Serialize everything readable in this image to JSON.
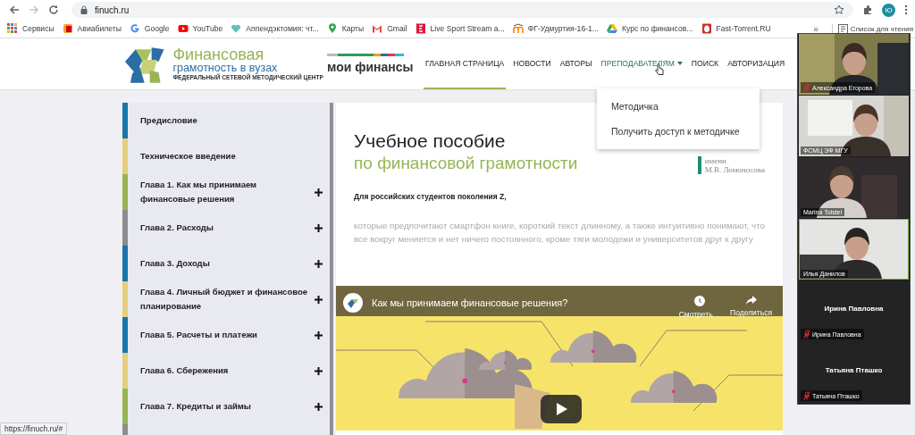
{
  "browser": {
    "address": "finuch.ru",
    "profile_initial": "Ю",
    "bookmarks": [
      {
        "label": "Сервисы",
        "kind": "apps"
      },
      {
        "label": "Авиабилеты",
        "kind": "ticket"
      },
      {
        "label": "Google",
        "kind": "google"
      },
      {
        "label": "YouTube",
        "kind": "youtube"
      },
      {
        "label": "Аппендэктомия: чт...",
        "kind": "heart"
      },
      {
        "label": "Карты",
        "kind": "maps"
      },
      {
        "label": "Gmail",
        "kind": "gmail"
      },
      {
        "label": "Live Sport Stream a...",
        "kind": "sport"
      },
      {
        "label": "ФГ-Удмуртия-16-1...",
        "kind": "moodle"
      },
      {
        "label": "Курс по финансов...",
        "kind": "drive"
      },
      {
        "label": "Fast-Torrent.RU",
        "kind": "torrent"
      }
    ],
    "overflow": "»",
    "reading_list": "Список для чтения",
    "status_url": "https://finuch.ru/#"
  },
  "site": {
    "logo": {
      "line_1": "Финансовая",
      "line_2": "грамотность в вузах",
      "line_3": "ФЕДЕРАЛЬНЫЙ СЕТЕВОЙ МЕТОДИЧЕСКИЙ ЦЕНТР"
    },
    "partner": "мои финансы",
    "nav": [
      {
        "label": "ГЛАВНАЯ СТРАНИЦА",
        "selected": true,
        "dropdown": false
      },
      {
        "label": "НОВОСТИ",
        "selected": false,
        "dropdown": false
      },
      {
        "label": "АВТОРЫ",
        "selected": false,
        "dropdown": false
      },
      {
        "label": "ПРЕПОДАВАТЕЛЯМ",
        "selected": false,
        "dropdown": true
      },
      {
        "label": "ПОИСК",
        "selected": false,
        "dropdown": false
      },
      {
        "label": "АВТОРИЗАЦИЯ",
        "selected": false,
        "dropdown": false
      }
    ],
    "dropdown_menu": [
      "Методичка",
      "Получить доступ к методичке"
    ]
  },
  "sidebar": {
    "items": [
      {
        "label": "Предисловие",
        "color": "#1a75a8",
        "expandable": false
      },
      {
        "label": "Техническое введение",
        "color": "#e3cf7f",
        "expandable": false
      },
      {
        "label": "Глава 1. Как мы принимаем финансовые решения",
        "color": "#98b456",
        "expandable": true
      },
      {
        "label": "Глава 2. Расходы",
        "color": "#8e8c8f",
        "expandable": true
      },
      {
        "label": "Глава 3. Доходы",
        "color": "#1a75a8",
        "expandable": true
      },
      {
        "label": "Глава 4. Личный бюджет и финансовое планирование",
        "color": "#e3cf7f",
        "expandable": true
      },
      {
        "label": "Глава 5. Расчеты и платежи",
        "color": "#1a75a8",
        "expandable": true
      },
      {
        "label": "Глава 6. Сбережения",
        "color": "#e3cf7f",
        "expandable": true
      },
      {
        "label": "Глава 7. Кредиты и займы",
        "color": "#98b456",
        "expandable": true
      },
      {
        "color": "#8e8c8f",
        "expandable": false
      }
    ]
  },
  "content": {
    "title": "Учебное пособие",
    "subtitle": "по финансовой грамотности",
    "university": [
      "имени",
      "М.В. Ломоносова"
    ],
    "lead": "Для российских студентов поколения Z,",
    "body": "которые предпочитают смартфон книге, короткий текст длинному, а также интуитивно понимают, что все вокруг меняется и нет ничего постоянного, кроме тяги молодежи и университетов друг к другу",
    "video": {
      "title": "Как мы принимаем финансовые решения?",
      "watch_later": "Смотреть ...",
      "share": "Поделиться"
    }
  },
  "meeting": {
    "participants": [
      {
        "name": "Александра Егорова",
        "kind": "video",
        "muted": true,
        "active": false
      },
      {
        "name": "ФСМЦ ЭФ МГУ",
        "kind": "video",
        "muted": false,
        "active": false
      },
      {
        "name": "Marina Tolstel",
        "kind": "video",
        "muted": false,
        "active": false
      },
      {
        "name": "Илья Данилов",
        "kind": "video",
        "muted": false,
        "active": true
      },
      {
        "name": "Ирина Павловна",
        "kind": "avatar",
        "display_name": "Ирина Павловна",
        "muted": true,
        "active": false
      },
      {
        "name": "Татьяна Пташко",
        "kind": "avatar",
        "display_name": "Татьяна Пташко",
        "muted": true,
        "active": false
      }
    ]
  }
}
